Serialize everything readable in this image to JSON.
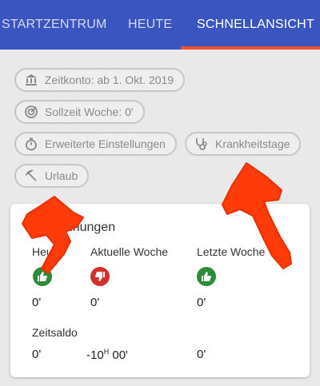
{
  "tabs": [
    {
      "label": "STARTZENTRUM",
      "active": false
    },
    {
      "label": "HEUTE",
      "active": false
    },
    {
      "label": "SCHNELLANSICHT",
      "active": true
    }
  ],
  "chips": {
    "zeitkonto": "Zeitkonto:  ab 1. Okt. 2019",
    "sollzeit": "Sollzeit Woche:  0'",
    "erweiterte": "Erweiterte Einstellungen",
    "krankheitstage": "Krankheitstage",
    "urlaub": "Urlaub"
  },
  "card": {
    "title": "Berechnungen",
    "columns": [
      "Heute",
      "Aktuelle Woche",
      "Letzte Woche"
    ],
    "status": [
      "thumbs-up",
      "thumbs-down",
      "thumbs-up"
    ],
    "values": [
      "0'",
      "0'",
      "0'"
    ],
    "zeitsaldo_label": "Zeitsaldo",
    "zeitsaldo": {
      "today": "0'",
      "week_hours": "-10",
      "week_hours_unit": "H",
      "week_minutes": " 00'",
      "last_week": "0'"
    }
  },
  "colors": {
    "appbar": "#3b55c0",
    "tab_indicator": "#f0512d",
    "thumb_up": "#2e8b3a",
    "thumb_down": "#d0312d",
    "annotation_arrow": "#ff3b0a"
  }
}
